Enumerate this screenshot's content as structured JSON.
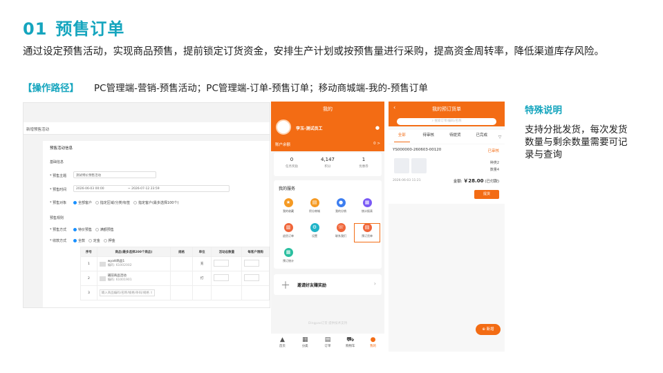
{
  "slide": {
    "title_num": "01",
    "title": "预售订单",
    "intro": "通过设定预售活动，实现商品预售，提前锁定订货资金，安排生产计划或按预售量进行采购，提高资金周转率，降低渠道库存风险。",
    "path_tag": "【操作路径】",
    "path_text": "PC管理端-营销-预售活动；PC管理端-订单-预售订单；移动商城端-我的-预售订单",
    "note_title": "特殊说明",
    "note_text": "支持分批发货，每次发货数量与剩余数量需要可记录与查询"
  },
  "pc": {
    "header": "新增预售活动",
    "section_info": "预售活动信息",
    "basic": "基础信息",
    "subject_label": "* 预售主题",
    "subject_value": "测试特价预售活动",
    "time_label": "* 预售时间",
    "time_start": "2026-06-03 00:00",
    "time_sep": "~ 2026-07-12 23:59",
    "target_label": "* 预售对象",
    "target_opts": [
      "全部客户",
      "指定区域/分类/标签",
      "指定客户(最多选择100个)"
    ],
    "rule": "预售规则",
    "mode_label": "* 预售方式",
    "mode_opts": [
      "特价预售",
      "满额预售"
    ],
    "deposit_label": "* 收款方式",
    "deposit_opts": [
      "全款",
      "定金",
      "押金"
    ],
    "columns": [
      "序号",
      "商品(最多选择200个商品)",
      "规格",
      "单位",
      "活动总数量",
      "每客户限购"
    ],
    "rows": [
      {
        "idx": "1",
        "name": "wyatt商品1",
        "code": "编码: 61002002",
        "unit": "充"
      },
      {
        "idx": "2",
        "name": "捕前商品活动",
        "code": "编码: 61001901",
        "unit": "打"
      },
      {
        "idx": "3",
        "name": "输入商品编码/名称/规格/条码/规格 ⇧",
        "code": "",
        "unit": ""
      }
    ]
  },
  "m1": {
    "title": "我的",
    "user": "李玉-测试员工",
    "account": "账户余额",
    "account_go": "0 >",
    "stats": [
      {
        "v": "0",
        "l": "任务奖励"
      },
      {
        "v": "4,147",
        "l": "积分"
      },
      {
        "v": "1",
        "l": "优惠券"
      }
    ],
    "services_title": "我的服务",
    "services": [
      {
        "label": "我的收藏",
        "color": "#f59a23",
        "glyph": "★"
      },
      {
        "label": "积分商城",
        "color": "#f59a23",
        "glyph": "▤"
      },
      {
        "label": "我的分销",
        "color": "#3d7ef0",
        "glyph": "●"
      },
      {
        "label": "统计报表",
        "color": "#7a5af5",
        "glyph": "▦"
      },
      {
        "label": "退货订单",
        "color": "#f0663a",
        "glyph": "▥"
      },
      {
        "label": "设置",
        "color": "#1fb4c8",
        "glyph": "⚙"
      },
      {
        "label": "联系我们",
        "color": "#f0663a",
        "glyph": "☏"
      },
      {
        "label": "预订货单",
        "color": "#f0663a",
        "glyph": "▤"
      },
      {
        "label": "预订统计",
        "color": "#2bbfa0",
        "glyph": "▦"
      }
    ],
    "invite": "邀请好友赚奖励",
    "brand": "Dingpao订货 提供技术支持",
    "tabs": [
      "首页",
      "分类",
      "订单",
      "购物车",
      "我的"
    ]
  },
  "m2": {
    "title": "我的预订货单",
    "search": "搜索订单/编码/名称",
    "tabs": [
      "全部",
      "待审核",
      "待提货",
      "已完成"
    ],
    "order_no": "YS000000-260603-00120",
    "order_status": "已审核",
    "qty1": "种类2",
    "qty2": "数量4",
    "date": "2026-06-03 11:21",
    "amount_label": "金额: ",
    "amount": "￥28.00",
    "amount_suffix": " (已付款)",
    "pay_btn": "提货",
    "add_btn": "新增"
  }
}
